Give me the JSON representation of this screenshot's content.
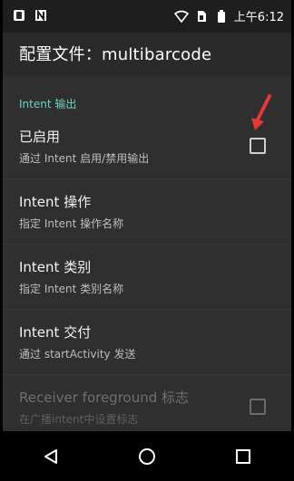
{
  "status_bar": {
    "time": "上午6:12",
    "icons": [
      "app-icon",
      "n-icon",
      "wifi-icon",
      "sim-icon",
      "battery-icon"
    ]
  },
  "app_bar": {
    "title": "配置文件：multibarcode"
  },
  "sections": [
    {
      "header": "Intent 输出",
      "items": [
        {
          "title": "已启用",
          "summary": "通过 Intent 启用/禁用输出",
          "has_checkbox": true,
          "checked": false,
          "enabled": true
        },
        {
          "title": "Intent 操作",
          "summary": "指定 Intent 操作名称",
          "has_checkbox": false,
          "enabled": true
        },
        {
          "title": "Intent 类别",
          "summary": "指定 Intent 类别名称",
          "has_checkbox": false,
          "enabled": true
        },
        {
          "title": "Intent 交付",
          "summary": "通过 startActivity 发送",
          "has_checkbox": false,
          "enabled": true
        },
        {
          "title": "Receiver foreground 标志",
          "summary": "在广播intent中设置标志",
          "has_checkbox": true,
          "checked": false,
          "enabled": false
        }
      ]
    }
  ],
  "nav_bar": {
    "buttons": [
      "back-icon",
      "home-icon",
      "recents-icon"
    ]
  },
  "colors": {
    "accent": "#6ad3c6",
    "annotation": "#e53935"
  }
}
